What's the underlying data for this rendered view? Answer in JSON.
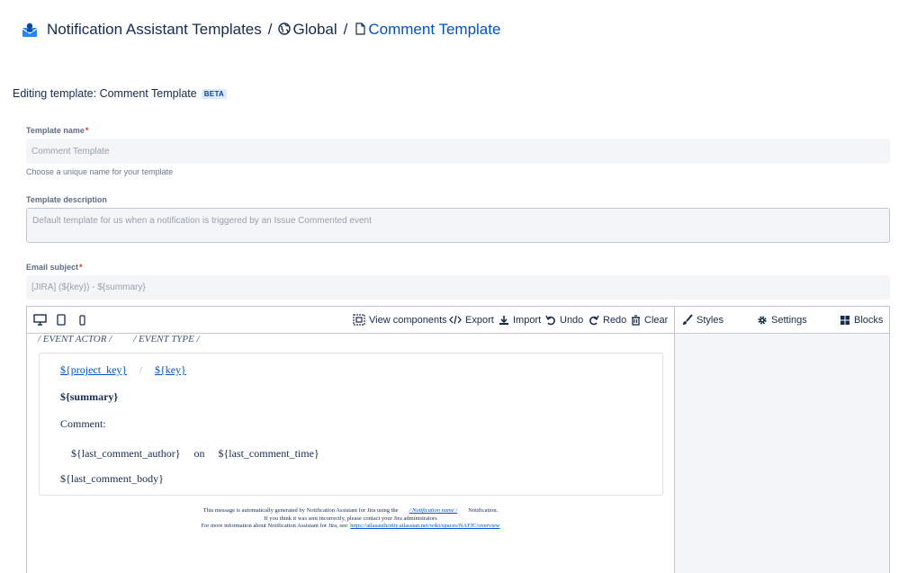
{
  "breadcrumb": {
    "app": "Notification Assistant Templates",
    "separator": "/",
    "scope": "Global",
    "current": "Comment Template"
  },
  "editing": {
    "title": "Editing template: Comment Template",
    "badge": "BETA"
  },
  "form": {
    "name_label": "Template name",
    "name_value": "Comment Template",
    "name_help": "Choose a unique name for your template",
    "description_label": "Template description",
    "description_value": "Default template for us when a notification is triggered by an Issue Commented event",
    "subject_label": "Email subject",
    "subject_value": "[JIRA] (${key}) - ${summary}",
    "required_mark": "*"
  },
  "toolbar": {
    "view_components": "View components",
    "export": "Export",
    "import": "Import",
    "undo": "Undo",
    "redo": "Redo",
    "clear": "Clear",
    "styles": "Styles",
    "settings": "Settings",
    "blocks": "Blocks"
  },
  "canvas": {
    "event_actor": "/ EVENT ACTOR /",
    "event_type": "/ EVENT TYPE /",
    "project_key": "${project_key}",
    "slash": "/",
    "key": "${key}",
    "summary": "${summary}",
    "comment_label": "Comment:",
    "comment_author": "${last_comment_author}",
    "on": "on",
    "comment_time": "${last_comment_time}",
    "comment_body": "${last_comment_body}",
    "footer_line1_pre": "This message is automatically generated by Notification Assistant for Jira using the",
    "footer_notification_name": "/ Notification name /",
    "footer_line1_post": "Notification.",
    "footer_line2": "If you think it was sent incorrectly, please contact your Jira administrators",
    "footer_line3_pre": "For more information about Notification Assistant for Jira, see:",
    "footer_url": "https://atlasauthority.atlassian.net/wiki/spaces/NAFJC/overview"
  },
  "colors": {
    "link": "#0052cc",
    "text": "#172b4d",
    "input_bg": "#f4f5f7",
    "required": "#de350b"
  }
}
